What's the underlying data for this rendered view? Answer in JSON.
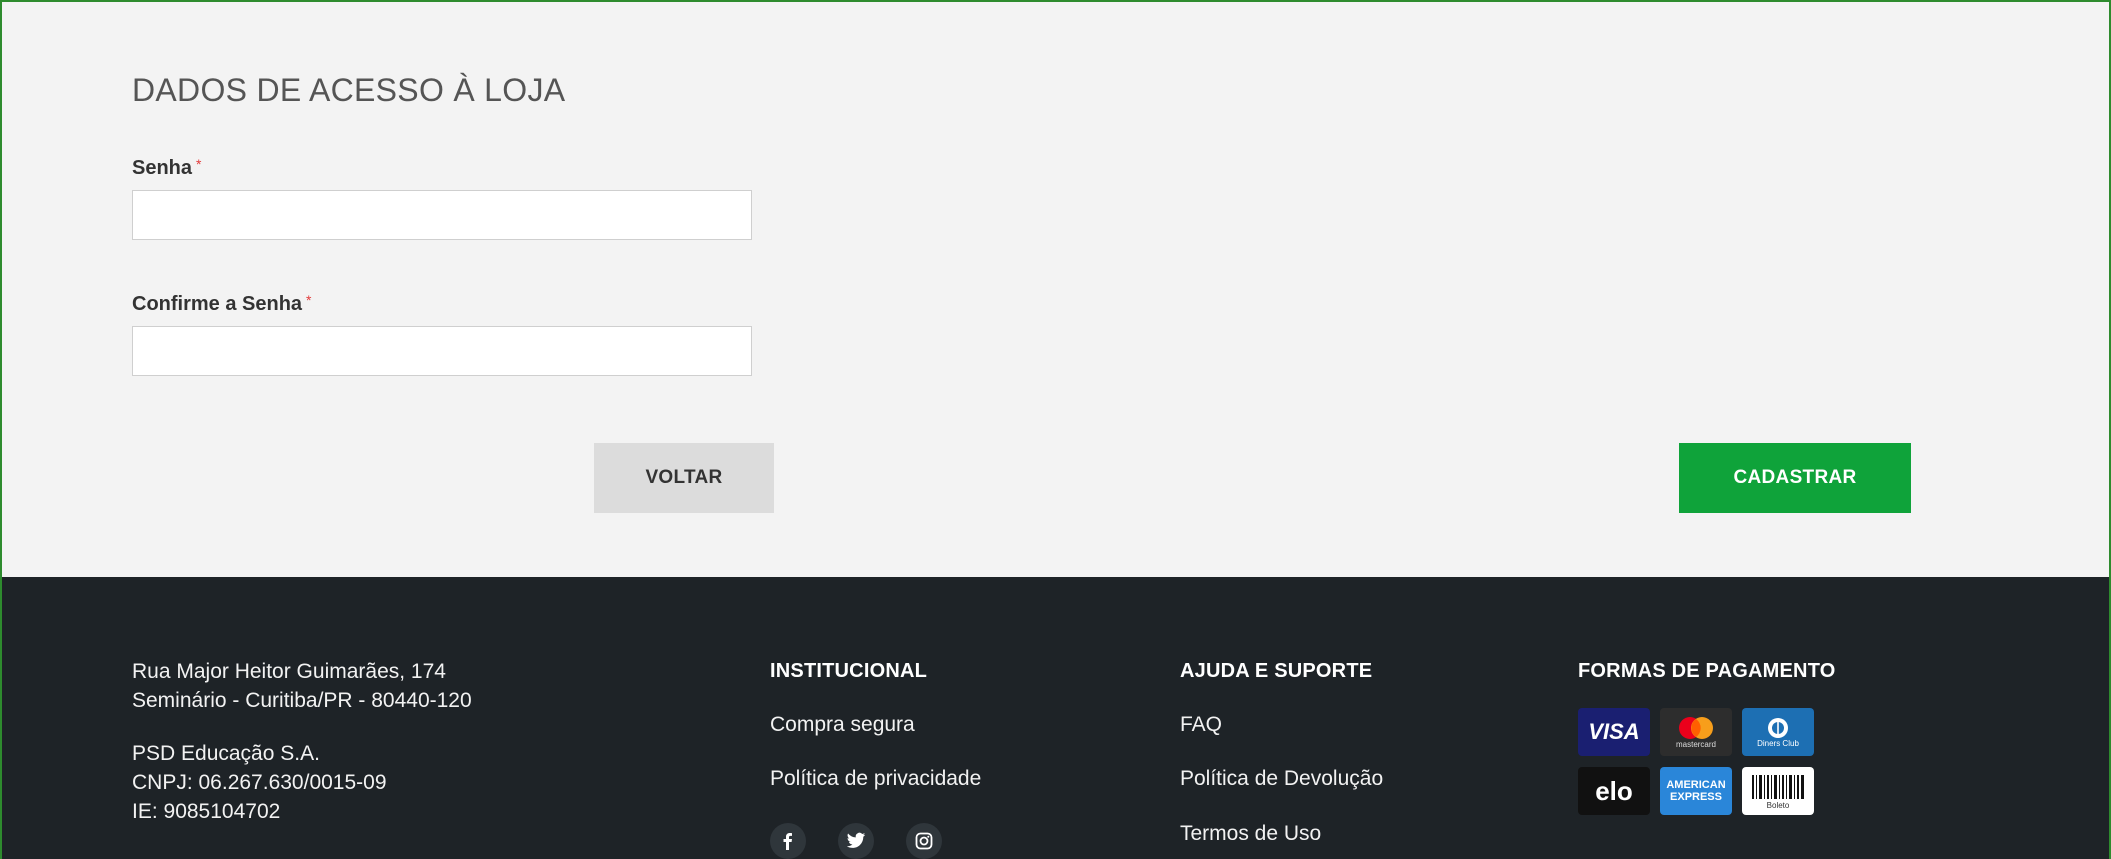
{
  "form": {
    "section_title": "DADOS DE ACESSO À LOJA",
    "password": {
      "label": "Senha",
      "required_mark": "*",
      "value": "",
      "placeholder": ""
    },
    "confirm_password": {
      "label": "Confirme a Senha",
      "required_mark": "*",
      "value": "",
      "placeholder": ""
    },
    "back_label": "VOLTAR",
    "submit_label": "CADASTRAR"
  },
  "colors": {
    "accent_green": "#0fa33a",
    "footer_bg": "#1e2327",
    "required_red": "#e23b3b",
    "frame_green": "#2e8b2e"
  },
  "footer": {
    "address": {
      "line1": "Rua Major Heitor Guimarães, 174",
      "line2": "Seminário - Curitiba/PR - 80440-120"
    },
    "company": {
      "name": "PSD Educação S.A.",
      "cnpj": "CNPJ: 06.267.630/0015-09",
      "ie": "IE: 9085104702"
    },
    "institucional": {
      "title": "INSTITUCIONAL",
      "links": [
        "Compra segura",
        "Política de privacidade"
      ]
    },
    "social": [
      {
        "icon": "facebook-icon",
        "glyph": "f"
      },
      {
        "icon": "twitter-icon",
        "glyph": "bird"
      },
      {
        "icon": "instagram-icon",
        "glyph": "camera"
      }
    ],
    "ajuda": {
      "title": "AJUDA E SUPORTE",
      "links": [
        "FAQ",
        "Política de Devolução",
        "Termos de Uso"
      ]
    },
    "pagamento": {
      "title": "FORMAS DE PAGAMENTO",
      "cards": {
        "visa": "VISA",
        "mastercard": "mastercard",
        "diners": "Diners Club",
        "elo": "elo",
        "amex_1": "AMERICAN",
        "amex_2": "EXPRESS",
        "boleto": "Boleto"
      }
    }
  }
}
